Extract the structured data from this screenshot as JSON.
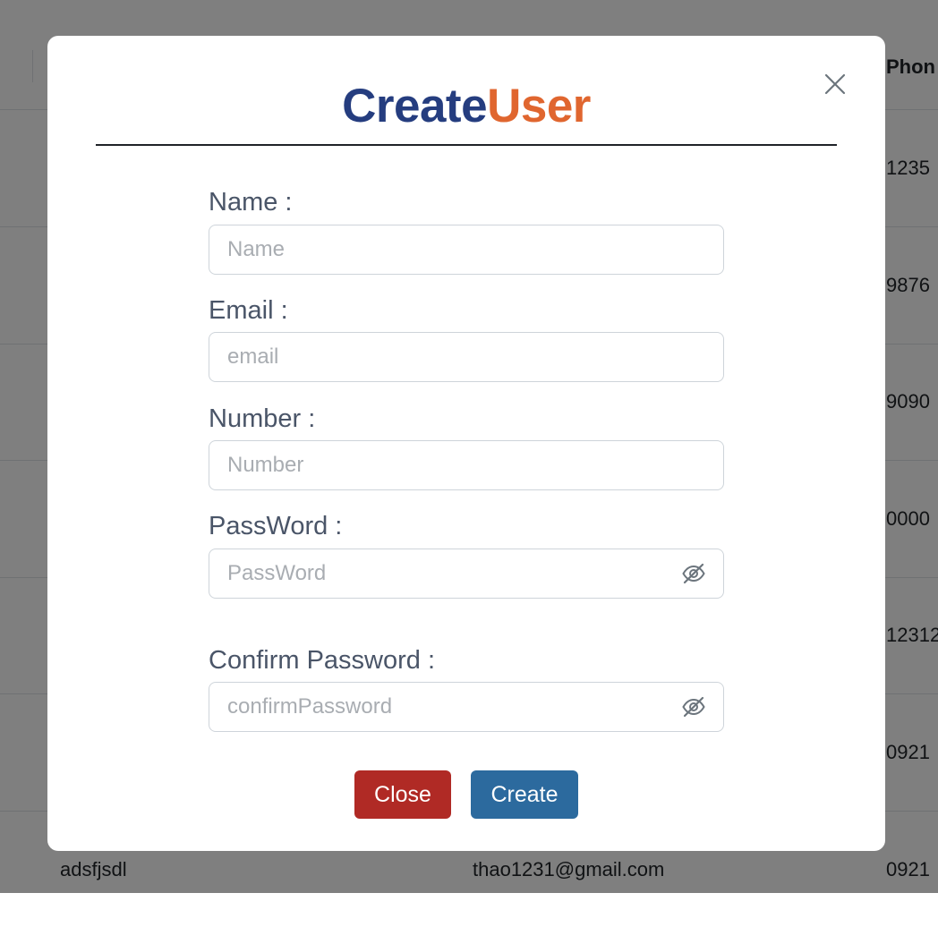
{
  "background_table": {
    "header": {
      "phone_label": "Phon"
    },
    "rows": [
      {
        "phone": "1235"
      },
      {
        "phone": "9876"
      },
      {
        "phone": "9090"
      },
      {
        "phone": "0000"
      },
      {
        "phone": "12312"
      },
      {
        "phone": "0921"
      }
    ],
    "last_row": {
      "name": "adsfjsdl",
      "email": "thao1231@gmail.com",
      "phone": "0921"
    }
  },
  "modal": {
    "title_part1": "Create",
    "title_part2": "User",
    "close_icon": "close-x-icon",
    "fields": [
      {
        "label": "Name :",
        "placeholder": "Name"
      },
      {
        "label": "Email :",
        "placeholder": "email"
      },
      {
        "label": "Number :",
        "placeholder": "Number"
      },
      {
        "label": "PassWord :",
        "placeholder": "PassWord",
        "icon": "eye-slash-icon"
      },
      {
        "label": "Confirm Password :",
        "placeholder": "confirmPassword",
        "icon": "eye-slash-icon"
      }
    ],
    "buttons": {
      "close_label": "Close",
      "create_label": "Create"
    }
  },
  "colors": {
    "title_primary": "#253d7f",
    "title_accent": "#e0662f",
    "close_button": "#b02a25",
    "create_button": "#2c6a9e",
    "overlay": "rgba(0,0,0,0.5)"
  }
}
